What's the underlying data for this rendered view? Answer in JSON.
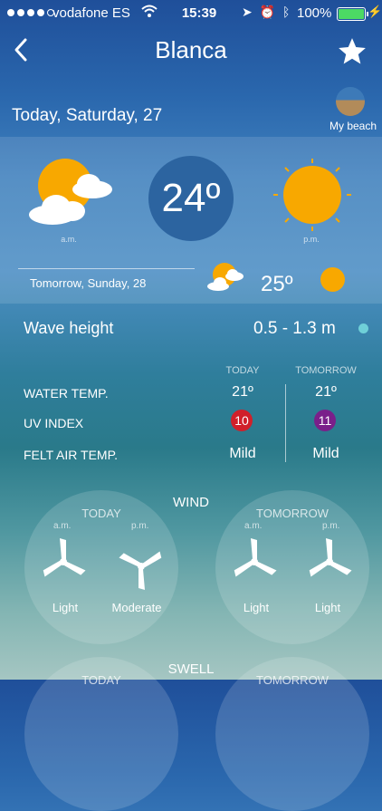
{
  "status_bar": {
    "carrier": "vodafone ES",
    "time": "15:39",
    "battery": "100%",
    "battery_fill": 1.0
  },
  "nav": {
    "title": "Blanca",
    "back_icon": "chevron-left-icon",
    "favorite_icon": "star-icon"
  },
  "header": {
    "date": "Today, Saturday, 27",
    "beach_label": "My beach"
  },
  "forecast": {
    "am_label": "a.m.",
    "pm_label": "p.m.",
    "current_temp": "24º",
    "tomorrow_label": "Tomorrow, Sunday, 28",
    "tomorrow_temp": "25º"
  },
  "wave": {
    "label": "Wave height",
    "value": "0.5 - 1.3 m"
  },
  "conditions": {
    "today_header": "TODAY",
    "tomorrow_header": "TOMORROW",
    "rows": [
      {
        "label": "WATER TEMP.",
        "today": "21º",
        "tomorrow": "21º"
      },
      {
        "label": "UV INDEX",
        "today": "10",
        "tomorrow": "11"
      },
      {
        "label": "FELT AIR TEMP.",
        "today": "Mild",
        "tomorrow": "Mild"
      }
    ],
    "uv_colors": {
      "today": "#d0202a",
      "tomorrow": "#7a1f8a"
    }
  },
  "wind": {
    "title": "WIND",
    "today": {
      "header": "TODAY",
      "am": "a.m.",
      "pm": "p.m.",
      "am_value": "Light",
      "pm_value": "Moderate"
    },
    "tomorrow": {
      "header": "TOMORROW",
      "am": "a.m.",
      "pm": "p.m.",
      "am_value": "Light",
      "pm_value": "Light"
    }
  },
  "swell": {
    "title": "SWELL",
    "today_header": "TODAY",
    "tomorrow_header": "TOMORROW"
  }
}
